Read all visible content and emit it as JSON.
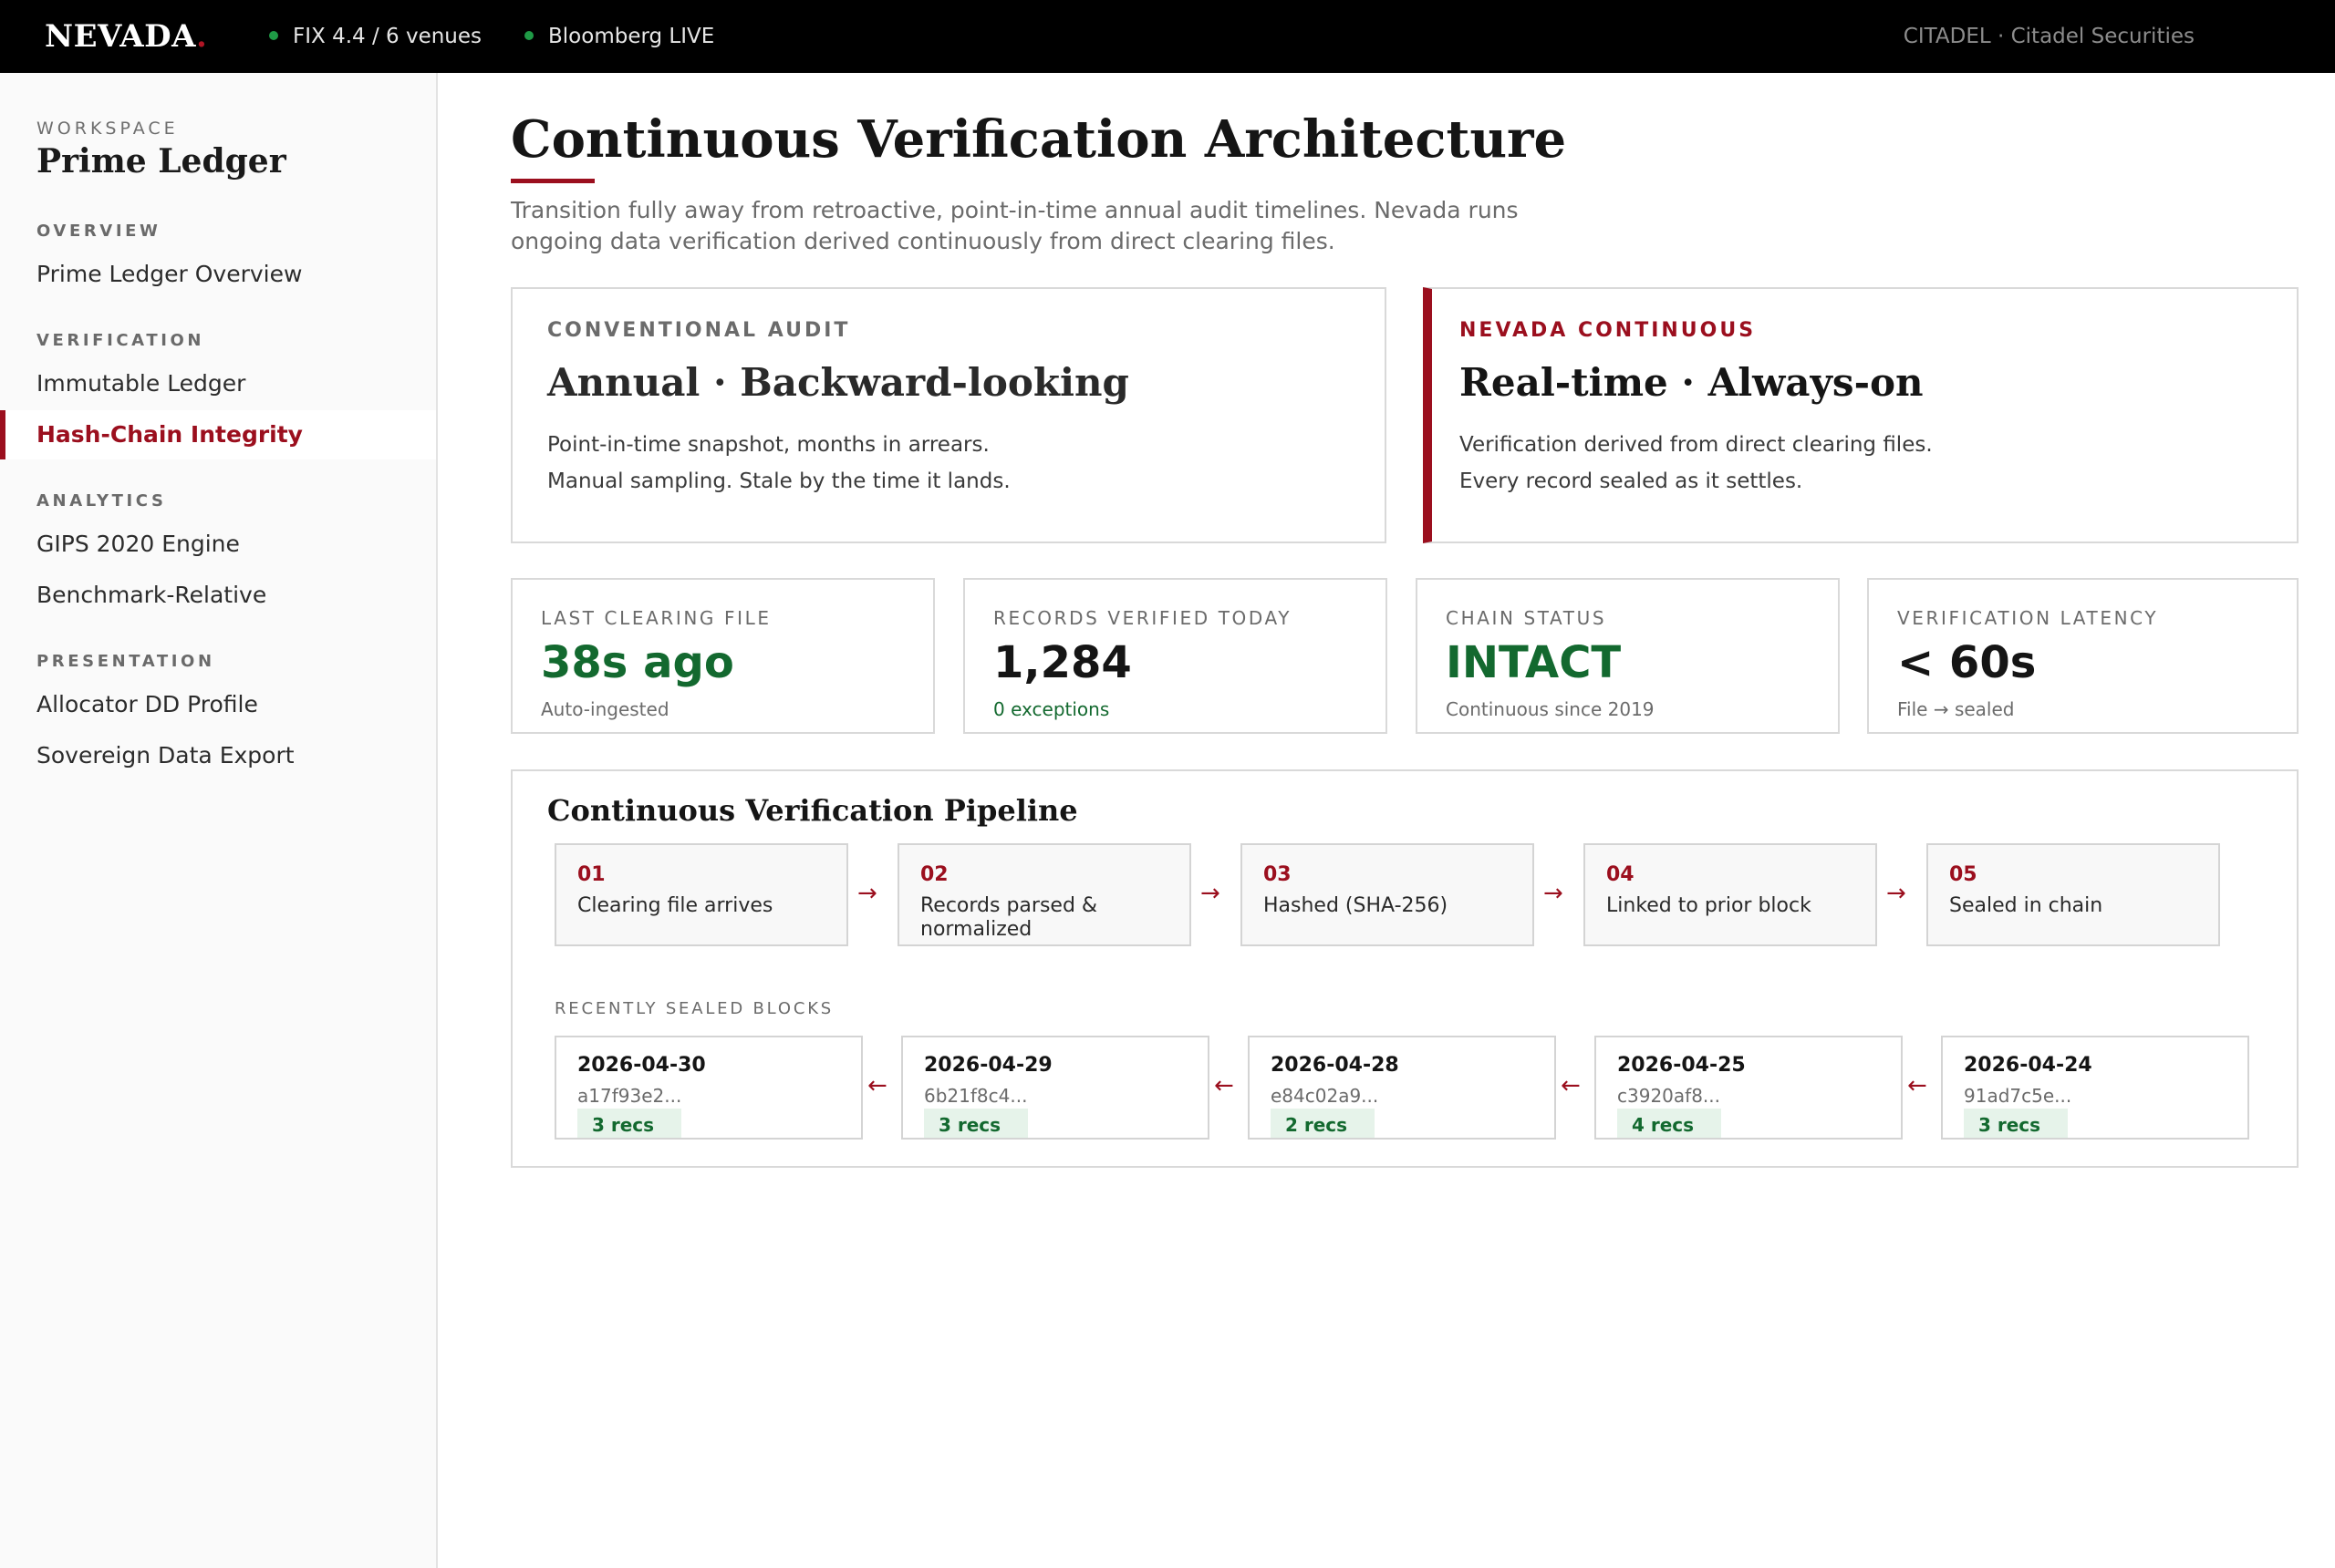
{
  "topbar": {
    "logo": "NEVADA",
    "logo_dot": ".",
    "status": [
      {
        "label": "FIX 4.4 / 6 venues"
      },
      {
        "label": "Bloomberg LIVE"
      }
    ],
    "account": "CITADEL · Citadel Securities",
    "status_color": "#1f9a46"
  },
  "sidebar": {
    "workspace_label": "WORKSPACE",
    "workspace_name": "Prime Ledger",
    "sections": [
      {
        "label": "OVERVIEW",
        "items": [
          {
            "label": "Prime Ledger Overview"
          }
        ]
      },
      {
        "label": "VERIFICATION",
        "items": [
          {
            "label": "Immutable Ledger"
          },
          {
            "label": "Hash-Chain Integrity",
            "active": true
          }
        ]
      },
      {
        "label": "ANALYTICS",
        "items": [
          {
            "label": "GIPS 2020 Engine"
          },
          {
            "label": "Benchmark-Relative"
          }
        ]
      },
      {
        "label": "PRESENTATION",
        "items": [
          {
            "label": "Allocator DD Profile"
          },
          {
            "label": "Sovereign Data Export"
          }
        ]
      }
    ]
  },
  "main": {
    "title": "Continuous Verification Architecture",
    "subtitle": "Transition fully away from retroactive, point-in-time annual audit timelines. Nevada runs ongoing data verification derived continuously from direct clearing files.",
    "accent_color": "#9b0f1e",
    "comparison": [
      {
        "kicker": "CONVENTIONAL AUDIT",
        "title": "Annual · Backward-looking",
        "lines": [
          "Point-in-time snapshot, months in arrears.",
          "Manual sampling. Stale by the time it lands."
        ]
      },
      {
        "kicker": "NEVADA CONTINUOUS",
        "title": "Real-time · Always-on",
        "lines": [
          "Verification derived from direct clearing files.",
          "Every record sealed as it settles."
        ]
      }
    ],
    "metrics": [
      {
        "label": "LAST CLEARING FILE",
        "value": "38s ago",
        "foot": "Auto-ingested"
      },
      {
        "label": "RECORDS VERIFIED TODAY",
        "value": "1,284",
        "foot": "0 exceptions"
      },
      {
        "label": "CHAIN STATUS",
        "value": "INTACT",
        "foot": "Continuous since 2019"
      },
      {
        "label": "VERIFICATION LATENCY",
        "value": "< 60s",
        "foot": "File → sealed"
      }
    ],
    "pipeline": {
      "title": "Continuous Verification Pipeline",
      "steps": [
        {
          "num": "01",
          "text": "Clearing file arrives"
        },
        {
          "num": "02",
          "text": "Records parsed & normalized"
        },
        {
          "num": "03",
          "text": "Hashed (SHA-256)"
        },
        {
          "num": "04",
          "text": "Linked to prior block"
        },
        {
          "num": "05",
          "text": "Sealed in chain"
        }
      ],
      "step_arrow": "→",
      "blocks_label": "RECENTLY SEALED BLOCKS",
      "block_arrow": "←",
      "blocks": [
        {
          "date": "2026-04-30",
          "hash": "a17f93e2...",
          "recs": "3 recs"
        },
        {
          "date": "2026-04-29",
          "hash": "6b21f8c4...",
          "recs": "3 recs"
        },
        {
          "date": "2026-04-28",
          "hash": "e84c02a9...",
          "recs": "2 recs"
        },
        {
          "date": "2026-04-25",
          "hash": "c3920af8...",
          "recs": "4 recs"
        },
        {
          "date": "2026-04-24",
          "hash": "91ad7c5e...",
          "recs": "3 recs"
        }
      ]
    }
  }
}
